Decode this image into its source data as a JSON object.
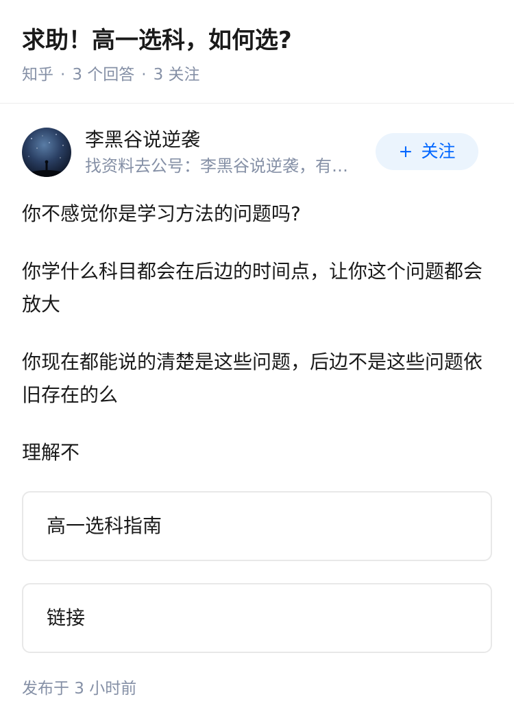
{
  "question": {
    "title": "求助！高一选科，如何选?",
    "source": "知乎",
    "answers": "3 个回答",
    "followers": "3 关注"
  },
  "author": {
    "name": "李黑谷说逆袭",
    "bio": "找资料去公号：李黑谷说逆袭，有…",
    "follow_label": "关注",
    "follow_icon": "plus-icon"
  },
  "answer": {
    "paragraphs": [
      "你不感觉你是学习方法的问题吗?",
      "你学什么科目都会在后边的时间点，让你这个问题都会放大",
      "你现在都能说的清楚是这些问题，后边不是这些问题依旧存在的么",
      "理解不"
    ],
    "cards": [
      "高一选科指南",
      "链接"
    ],
    "published": "发布于 3 小时前"
  },
  "colors": {
    "accent": "#0066ff",
    "follow_bg": "#ebf4fd",
    "meta_text": "#8590a6"
  }
}
